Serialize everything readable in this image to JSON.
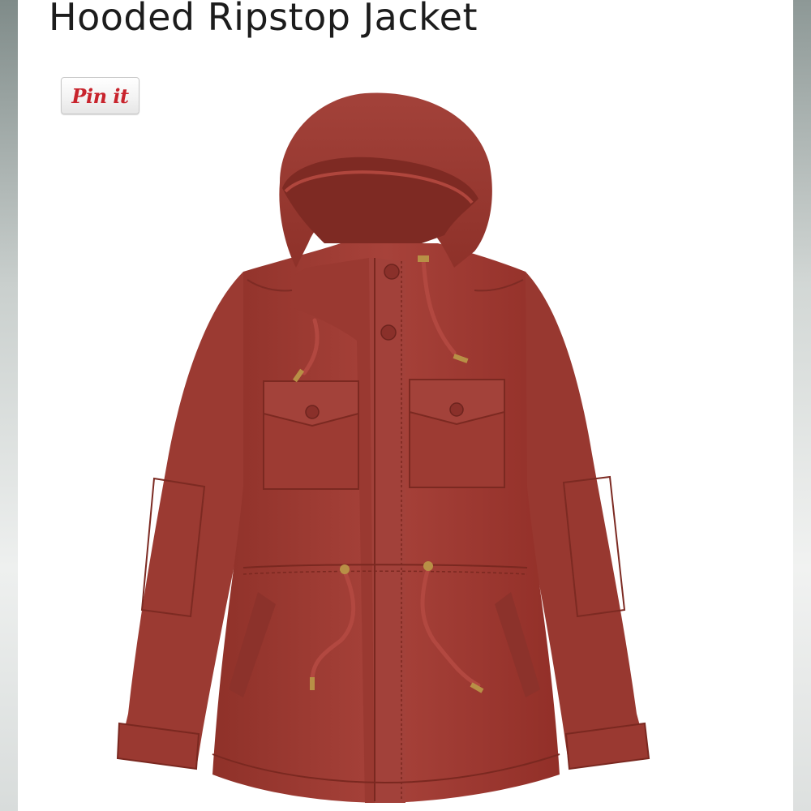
{
  "product": {
    "title": "Hooded Ripstop Jacket",
    "color": "#a23d34"
  },
  "pin_button": {
    "label": "Pin it",
    "color": "#c8232c"
  }
}
